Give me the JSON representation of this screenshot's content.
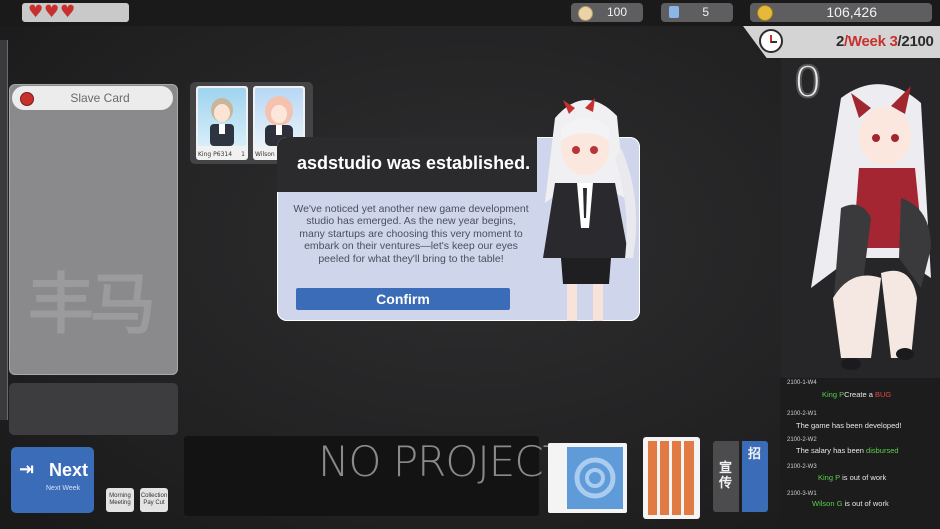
{
  "hud": {
    "hearts": 3,
    "food": "100",
    "cards": "5",
    "money": "106,426",
    "date": {
      "year": "2",
      "sep": "/",
      "week": "Week 3",
      "slash": "/",
      "total": "2100"
    }
  },
  "slave_card": {
    "title": "Slave Card",
    "watermark": "丰马"
  },
  "employees": [
    {
      "name": "King P",
      "tag": "6314",
      "level": "1"
    },
    {
      "name": "Wilson G",
      "tag": "",
      "level": ""
    }
  ],
  "dialog": {
    "title": "asdstudio was established.",
    "body": "We've noticed yet another new game development studio has emerged. As the new year begins, many startups are choosing this very moment to embark on their ventures—let's keep our eyes peeled for what they'll bring to the table!",
    "confirm_label": "Confirm"
  },
  "side_counter": "0",
  "log": [
    {
      "date": "2100-1-W4",
      "name": "King P",
      "text": "Create a ",
      "hl": "BUG",
      "hl_color": "red"
    },
    {
      "date": "2100-2-W1",
      "name": "",
      "text": "The game has been developed!",
      "hl": "",
      "hl_color": ""
    },
    {
      "date": "2100-2-W2",
      "name": "",
      "text": "The salary has been ",
      "hl": "disbursed",
      "hl_color": "green"
    },
    {
      "date": "2100-2-W3",
      "name": "King P",
      "text": "is out of work",
      "hl": "",
      "hl_color": ""
    },
    {
      "date": "2100-3-W1",
      "name": "Wilson G",
      "text": "is out of work",
      "hl": "",
      "hl_color": ""
    }
  ],
  "bottom": {
    "next_label": "Next",
    "next_sub": "Next Week",
    "meeting_label": "Morning Meeting",
    "paycut_label": "Collection Pay Cut",
    "project_label": "NO PROJECT",
    "book_left": "宣传",
    "book_right": "招"
  },
  "colors": {
    "accent_blue": "#3a6cb8",
    "heart_red": "#c8302e",
    "log_green": "#58d04a",
    "log_red": "#e0473f"
  }
}
